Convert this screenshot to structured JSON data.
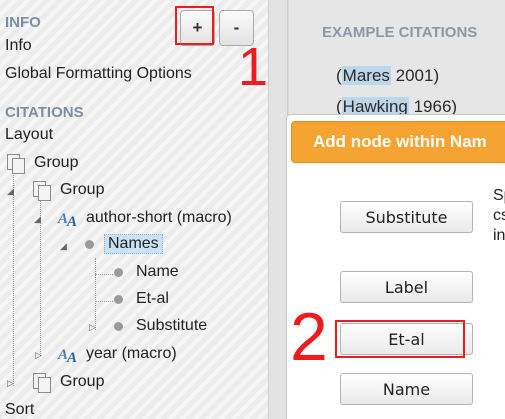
{
  "left_panel": {
    "info_heading": "INFO",
    "info_items": [
      "Info",
      "Global Formatting Options"
    ],
    "citations_heading": "CITATIONS",
    "layout_label": "Layout",
    "sort_label": "Sort",
    "add_button": "+",
    "remove_button": "-",
    "tree": {
      "group1": "Group",
      "group2": "Group",
      "author_macro": "author-short (macro)",
      "names": "Names",
      "name": "Name",
      "et_al": "Et-al",
      "substitute": "Substitute",
      "year_macro": "year (macro)",
      "group3": "Group"
    }
  },
  "examples": {
    "heading": "EXAMPLE CITATIONS",
    "citations": [
      {
        "open": "(",
        "highlight": "Mares",
        "rest": " 2001)"
      },
      {
        "open": "(",
        "highlight": "Hawking",
        "rest": " 1966)"
      }
    ]
  },
  "dialog": {
    "title": "Add node within Nam",
    "buttons": [
      "Substitute",
      "Label",
      "Et-al",
      "Name"
    ],
    "description_lines": [
      "Sp",
      "cs",
      "in"
    ]
  },
  "annotations": {
    "step1": "1",
    "step2": "2",
    "color": "#ee1c1c"
  },
  "colors": {
    "dialog_title_bg": "#f5a433",
    "section_heading": "#7a8fa6",
    "selection": "#c9e3f5"
  }
}
